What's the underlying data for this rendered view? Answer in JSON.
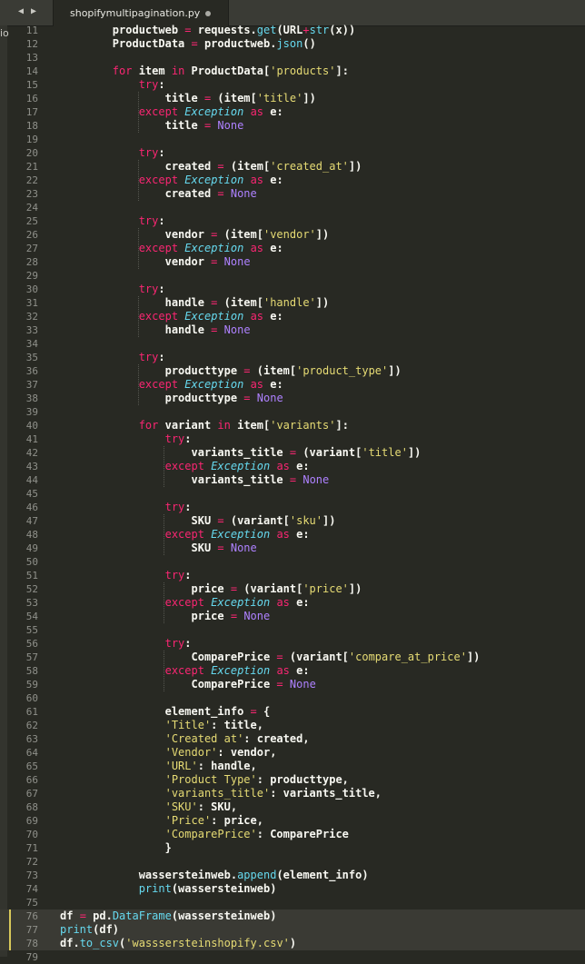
{
  "tab": {
    "title": "shopifymultipagination.py"
  },
  "left_edge_label": "io",
  "colors": {
    "background": "#282923",
    "keyword": "#f92672",
    "string": "#e6db74",
    "constant": "#ae81ff",
    "builtin": "#66d9ef"
  },
  "lines": [
    {
      "n": "11",
      "t": "        productweb = requests.get(URL+str(x))"
    },
    {
      "n": "12",
      "t": "        ProductData = productweb.json()"
    },
    {
      "n": "13",
      "t": ""
    },
    {
      "n": "14",
      "t": "        for item in ProductData['products']:"
    },
    {
      "n": "15",
      "t": "            try:"
    },
    {
      "n": "16",
      "t": "                title = (item['title'])"
    },
    {
      "n": "17",
      "t": "            except Exception as e:"
    },
    {
      "n": "18",
      "t": "                title = None"
    },
    {
      "n": "19",
      "t": ""
    },
    {
      "n": "20",
      "t": "            try:"
    },
    {
      "n": "21",
      "t": "                created = (item['created_at'])"
    },
    {
      "n": "22",
      "t": "            except Exception as e:"
    },
    {
      "n": "23",
      "t": "                created = None"
    },
    {
      "n": "24",
      "t": ""
    },
    {
      "n": "25",
      "t": "            try:"
    },
    {
      "n": "26",
      "t": "                vendor = (item['vendor'])"
    },
    {
      "n": "27",
      "t": "            except Exception as e:"
    },
    {
      "n": "28",
      "t": "                vendor = None"
    },
    {
      "n": "29",
      "t": ""
    },
    {
      "n": "30",
      "t": "            try:"
    },
    {
      "n": "31",
      "t": "                handle = (item['handle'])"
    },
    {
      "n": "32",
      "t": "            except Exception as e:"
    },
    {
      "n": "33",
      "t": "                handle = None"
    },
    {
      "n": "34",
      "t": ""
    },
    {
      "n": "35",
      "t": "            try:"
    },
    {
      "n": "36",
      "t": "                producttype = (item['product_type'])"
    },
    {
      "n": "37",
      "t": "            except Exception as e:"
    },
    {
      "n": "38",
      "t": "                producttype = None"
    },
    {
      "n": "39",
      "t": ""
    },
    {
      "n": "40",
      "t": "            for variant in item['variants']:"
    },
    {
      "n": "41",
      "t": "                try:"
    },
    {
      "n": "42",
      "t": "                    variants_title = (variant['title'])"
    },
    {
      "n": "43",
      "t": "                except Exception as e:"
    },
    {
      "n": "44",
      "t": "                    variants_title = None"
    },
    {
      "n": "45",
      "t": ""
    },
    {
      "n": "46",
      "t": "                try:"
    },
    {
      "n": "47",
      "t": "                    SKU = (variant['sku'])"
    },
    {
      "n": "48",
      "t": "                except Exception as e:"
    },
    {
      "n": "49",
      "t": "                    SKU = None"
    },
    {
      "n": "50",
      "t": ""
    },
    {
      "n": "51",
      "t": "                try:"
    },
    {
      "n": "52",
      "t": "                    price = (variant['price'])"
    },
    {
      "n": "53",
      "t": "                except Exception as e:"
    },
    {
      "n": "54",
      "t": "                    price = None"
    },
    {
      "n": "55",
      "t": ""
    },
    {
      "n": "56",
      "t": "                try:"
    },
    {
      "n": "57",
      "t": "                    ComparePrice = (variant['compare_at_price'])"
    },
    {
      "n": "58",
      "t": "                except Exception as e:"
    },
    {
      "n": "59",
      "t": "                    ComparePrice = None"
    },
    {
      "n": "60",
      "t": ""
    },
    {
      "n": "61",
      "t": "                element_info = {"
    },
    {
      "n": "62",
      "t": "                'Title': title,"
    },
    {
      "n": "63",
      "t": "                'Created at': created,"
    },
    {
      "n": "64",
      "t": "                'Vendor': vendor,"
    },
    {
      "n": "65",
      "t": "                'URL': handle,"
    },
    {
      "n": "66",
      "t": "                'Product Type': producttype,"
    },
    {
      "n": "67",
      "t": "                'variants_title': variants_title,"
    },
    {
      "n": "68",
      "t": "                'SKU': SKU,"
    },
    {
      "n": "69",
      "t": "                'Price': price,"
    },
    {
      "n": "70",
      "t": "                'ComparePrice': ComparePrice"
    },
    {
      "n": "71",
      "t": "                }"
    },
    {
      "n": "72",
      "t": ""
    },
    {
      "n": "73",
      "t": "            wassersteinweb.append(element_info)"
    },
    {
      "n": "74",
      "t": "            print(wassersteinweb)"
    },
    {
      "n": "75",
      "t": ""
    },
    {
      "n": "76",
      "t": "df = pd.DataFrame(wassersteinweb)",
      "hl": true
    },
    {
      "n": "77",
      "t": "print(df)",
      "hl": true
    },
    {
      "n": "78",
      "t": "df.to_csv('wasssersteinshopify.csv')",
      "hl": true
    },
    {
      "n": "79",
      "t": ""
    }
  ]
}
